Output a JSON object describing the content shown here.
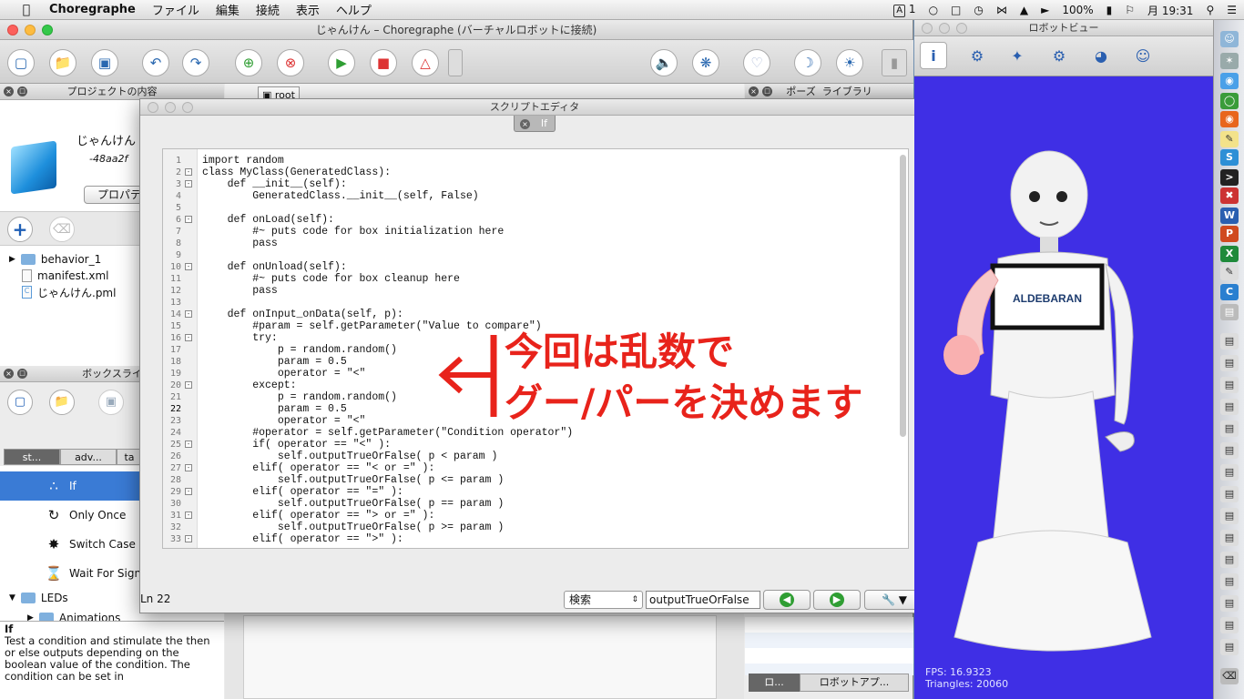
{
  "menubar": {
    "app_name": "Choregraphe",
    "menus": [
      "ファイル",
      "編集",
      "接続",
      "表示",
      "ヘルプ"
    ],
    "status_num": "1",
    "battery": "100%",
    "clock": "月 19:31"
  },
  "main_window": {
    "title": "じゃんけん – Choregraphe (バーチャルロボットに接続)"
  },
  "project_panel": {
    "title": "プロジェクトの内容",
    "project_name": "じゃんけん",
    "project_id": "-48aa2f",
    "properties_button": "プロパテ",
    "tree": [
      {
        "label": "behavior_1",
        "kind": "folder"
      },
      {
        "label": "manifest.xml",
        "kind": "file"
      },
      {
        "label": "じゃんけん.pml",
        "kind": "file"
      }
    ]
  },
  "flow_panel": {
    "breadcrumb": "root"
  },
  "poses_panel": {
    "tab_poses": "ポーズ",
    "tab_library": "ライブラリ",
    "bottom_tab_1": "ロ...",
    "bottom_tab_2": "ロボットアプ..."
  },
  "box_library": {
    "title": "ボックスライ",
    "tabs": [
      "st...",
      "adv...",
      "ta"
    ],
    "items": [
      {
        "label": "If",
        "selected": true
      },
      {
        "label": "Only Once",
        "selected": false
      },
      {
        "label": "Switch Case",
        "selected": false
      },
      {
        "label": "Wait For Sign",
        "selected": false
      }
    ],
    "folders": [
      "LEDs",
      "Animations"
    ],
    "description_title": "If",
    "description": "Test a condition and stimulate the then or else outputs depending on the boolean value of the condition. The condition can be set in"
  },
  "script_editor": {
    "title": "スクリプトエディタ",
    "tab": "If",
    "line_numbers": [
      "1",
      "2",
      "3",
      "4",
      "5",
      "6",
      "7",
      "8",
      "9",
      "10",
      "11",
      "12",
      "13",
      "14",
      "15",
      "16",
      "17",
      "18",
      "19",
      "20",
      "21",
      "22",
      "23",
      "24",
      "25",
      "26",
      "27",
      "28",
      "29",
      "30",
      "31",
      "32",
      "33"
    ],
    "code_lines": [
      "import random",
      "class MyClass(GeneratedClass):",
      "    def __init__(self):",
      "        GeneratedClass.__init__(self, False)",
      "",
      "    def onLoad(self):",
      "        #~ puts code for box initialization here",
      "        pass",
      "",
      "    def onUnload(self):",
      "        #~ puts code for box cleanup here",
      "        pass",
      "",
      "    def onInput_onData(self, p):",
      "        #param = self.getParameter(\"Value to compare\")",
      "        try:",
      "            p = random.random()",
      "            param = 0.5",
      "            operator = \"<\"",
      "        except:",
      "            p = random.random()",
      "            param = 0.5",
      "            operator = \"<\"",
      "        #operator = self.getParameter(\"Condition operator\")",
      "        if( operator == \"<\" ):",
      "            self.outputTrueOrFalse( p < param )",
      "        elif( operator == \"< or =\" ):",
      "            self.outputTrueOrFalse( p <= param )",
      "        elif( operator == \"=\" ):",
      "            self.outputTrueOrFalse( p == param )",
      "        elif( operator == \"> or =\" ):",
      "            self.outputTrueOrFalse( p >= param )",
      "        elif( operator == \">\" ):"
    ],
    "status_line": "Ln 22",
    "search_mode": "検索",
    "search_value": "outputTrueOrFalse"
  },
  "annotation": {
    "line1": "今回は乱数で",
    "line2": "グー/パーを決めます",
    "color": "#e8231b"
  },
  "robot_view": {
    "title": "ロボットビュー",
    "logo_text": "ALDEBARAN",
    "fps": "FPS: 16.9323",
    "triangles": "Triangles: 20060",
    "background": "#3f2fe5"
  }
}
